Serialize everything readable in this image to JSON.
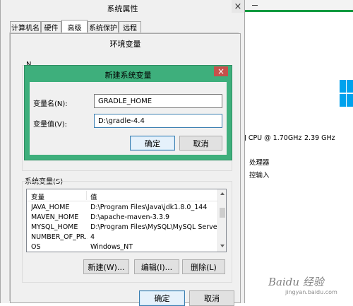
{
  "background_window": {
    "cpu_text": "J CPU @ 1.70GHz",
    "cpu_speed": "2.39 GHz",
    "processor_text": "处理器",
    "input_text": "控输入",
    "accent_color": "#00a2ed",
    "green_bar_color": "#129a3f"
  },
  "system_properties": {
    "title": "系统属性",
    "tabs": [
      "计算机名",
      "硬件",
      "高级",
      "系统保护",
      "远程"
    ],
    "active_tab": "高级",
    "close_symbol": "×"
  },
  "env_vars": {
    "title": "环境变量",
    "partial_user_section_label": "N",
    "system_vars_label": "系统变量(S)",
    "columns": [
      "变量",
      "值"
    ],
    "rows": [
      {
        "name": "JAVA_HOME",
        "value": "D:\\Program Files\\Java\\jdk1.8.0_144"
      },
      {
        "name": "MAVEN_HOME",
        "value": "D:\\apache-maven-3.3.9"
      },
      {
        "name": "MYSQL_HOME",
        "value": "D:\\Program Files\\MySQL\\MySQL Server ..."
      },
      {
        "name": "NUMBER_OF_PR...",
        "value": "4"
      },
      {
        "name": "OS",
        "value": "Windows_NT"
      }
    ],
    "new_button": "新建(W)...",
    "edit_button": "编辑(I)...",
    "delete_button": "删除(L)",
    "ok_button": "确定",
    "cancel_button": "取消"
  },
  "new_var_dialog": {
    "title": "新建系统变量",
    "name_label": "变量名(N):",
    "name_value": "GRADLE_HOME",
    "value_label": "变量值(V):",
    "value_value": "D:\\gradle-4.4",
    "ok_button": "确定",
    "cancel_button": "取消",
    "close_symbol": "×",
    "frame_color": "#3eaf7c",
    "close_color": "#c7504b"
  },
  "watermark": {
    "text": "Baidu 经验",
    "url": "jingyan.baidu.com"
  }
}
